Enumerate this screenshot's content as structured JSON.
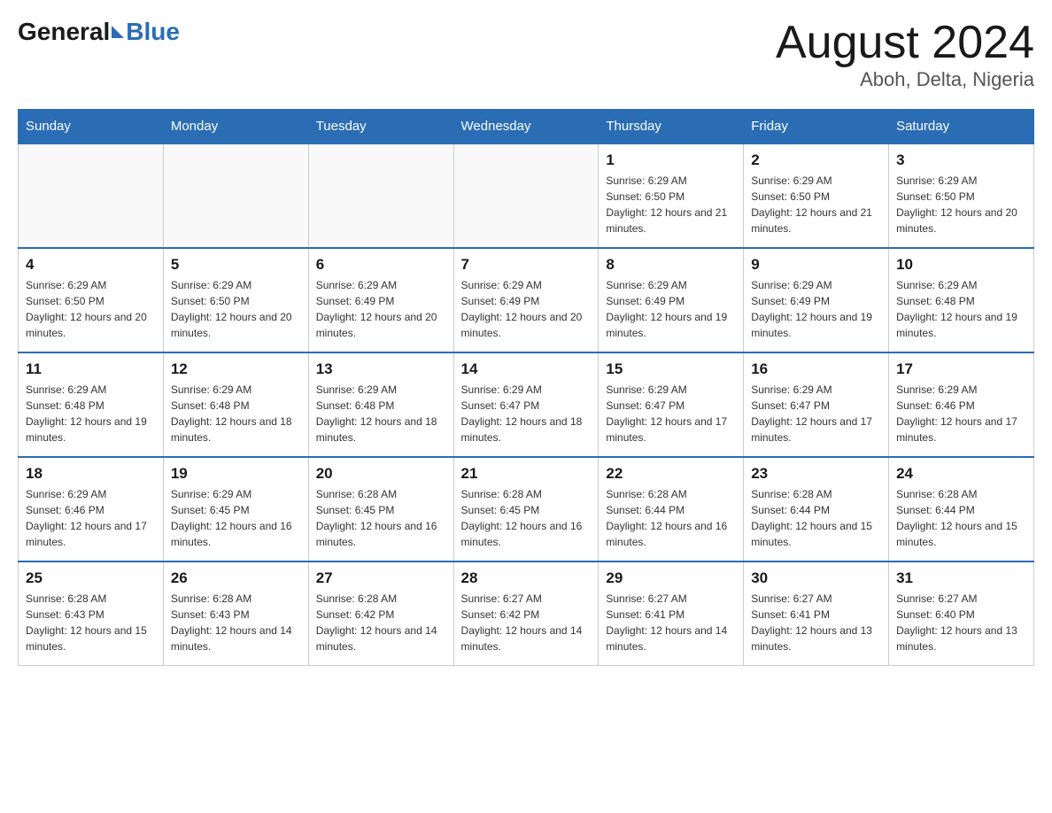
{
  "header": {
    "logo": {
      "general": "General",
      "blue": "Blue"
    },
    "month_title": "August 2024",
    "location": "Aboh, Delta, Nigeria"
  },
  "days_of_week": [
    "Sunday",
    "Monday",
    "Tuesday",
    "Wednesday",
    "Thursday",
    "Friday",
    "Saturday"
  ],
  "weeks": [
    [
      {
        "day": "",
        "info": ""
      },
      {
        "day": "",
        "info": ""
      },
      {
        "day": "",
        "info": ""
      },
      {
        "day": "",
        "info": ""
      },
      {
        "day": "1",
        "info": "Sunrise: 6:29 AM\nSunset: 6:50 PM\nDaylight: 12 hours and 21 minutes."
      },
      {
        "day": "2",
        "info": "Sunrise: 6:29 AM\nSunset: 6:50 PM\nDaylight: 12 hours and 21 minutes."
      },
      {
        "day": "3",
        "info": "Sunrise: 6:29 AM\nSunset: 6:50 PM\nDaylight: 12 hours and 20 minutes."
      }
    ],
    [
      {
        "day": "4",
        "info": "Sunrise: 6:29 AM\nSunset: 6:50 PM\nDaylight: 12 hours and 20 minutes."
      },
      {
        "day": "5",
        "info": "Sunrise: 6:29 AM\nSunset: 6:50 PM\nDaylight: 12 hours and 20 minutes."
      },
      {
        "day": "6",
        "info": "Sunrise: 6:29 AM\nSunset: 6:49 PM\nDaylight: 12 hours and 20 minutes."
      },
      {
        "day": "7",
        "info": "Sunrise: 6:29 AM\nSunset: 6:49 PM\nDaylight: 12 hours and 20 minutes."
      },
      {
        "day": "8",
        "info": "Sunrise: 6:29 AM\nSunset: 6:49 PM\nDaylight: 12 hours and 19 minutes."
      },
      {
        "day": "9",
        "info": "Sunrise: 6:29 AM\nSunset: 6:49 PM\nDaylight: 12 hours and 19 minutes."
      },
      {
        "day": "10",
        "info": "Sunrise: 6:29 AM\nSunset: 6:48 PM\nDaylight: 12 hours and 19 minutes."
      }
    ],
    [
      {
        "day": "11",
        "info": "Sunrise: 6:29 AM\nSunset: 6:48 PM\nDaylight: 12 hours and 19 minutes."
      },
      {
        "day": "12",
        "info": "Sunrise: 6:29 AM\nSunset: 6:48 PM\nDaylight: 12 hours and 18 minutes."
      },
      {
        "day": "13",
        "info": "Sunrise: 6:29 AM\nSunset: 6:48 PM\nDaylight: 12 hours and 18 minutes."
      },
      {
        "day": "14",
        "info": "Sunrise: 6:29 AM\nSunset: 6:47 PM\nDaylight: 12 hours and 18 minutes."
      },
      {
        "day": "15",
        "info": "Sunrise: 6:29 AM\nSunset: 6:47 PM\nDaylight: 12 hours and 17 minutes."
      },
      {
        "day": "16",
        "info": "Sunrise: 6:29 AM\nSunset: 6:47 PM\nDaylight: 12 hours and 17 minutes."
      },
      {
        "day": "17",
        "info": "Sunrise: 6:29 AM\nSunset: 6:46 PM\nDaylight: 12 hours and 17 minutes."
      }
    ],
    [
      {
        "day": "18",
        "info": "Sunrise: 6:29 AM\nSunset: 6:46 PM\nDaylight: 12 hours and 17 minutes."
      },
      {
        "day": "19",
        "info": "Sunrise: 6:29 AM\nSunset: 6:45 PM\nDaylight: 12 hours and 16 minutes."
      },
      {
        "day": "20",
        "info": "Sunrise: 6:28 AM\nSunset: 6:45 PM\nDaylight: 12 hours and 16 minutes."
      },
      {
        "day": "21",
        "info": "Sunrise: 6:28 AM\nSunset: 6:45 PM\nDaylight: 12 hours and 16 minutes."
      },
      {
        "day": "22",
        "info": "Sunrise: 6:28 AM\nSunset: 6:44 PM\nDaylight: 12 hours and 16 minutes."
      },
      {
        "day": "23",
        "info": "Sunrise: 6:28 AM\nSunset: 6:44 PM\nDaylight: 12 hours and 15 minutes."
      },
      {
        "day": "24",
        "info": "Sunrise: 6:28 AM\nSunset: 6:44 PM\nDaylight: 12 hours and 15 minutes."
      }
    ],
    [
      {
        "day": "25",
        "info": "Sunrise: 6:28 AM\nSunset: 6:43 PM\nDaylight: 12 hours and 15 minutes."
      },
      {
        "day": "26",
        "info": "Sunrise: 6:28 AM\nSunset: 6:43 PM\nDaylight: 12 hours and 14 minutes."
      },
      {
        "day": "27",
        "info": "Sunrise: 6:28 AM\nSunset: 6:42 PM\nDaylight: 12 hours and 14 minutes."
      },
      {
        "day": "28",
        "info": "Sunrise: 6:27 AM\nSunset: 6:42 PM\nDaylight: 12 hours and 14 minutes."
      },
      {
        "day": "29",
        "info": "Sunrise: 6:27 AM\nSunset: 6:41 PM\nDaylight: 12 hours and 14 minutes."
      },
      {
        "day": "30",
        "info": "Sunrise: 6:27 AM\nSunset: 6:41 PM\nDaylight: 12 hours and 13 minutes."
      },
      {
        "day": "31",
        "info": "Sunrise: 6:27 AM\nSunset: 6:40 PM\nDaylight: 12 hours and 13 minutes."
      }
    ]
  ],
  "colors": {
    "header_bg": "#2a6db5",
    "header_text": "#ffffff",
    "border": "#aaaaaa",
    "day_number": "#1a1a1a",
    "day_info": "#333333"
  }
}
